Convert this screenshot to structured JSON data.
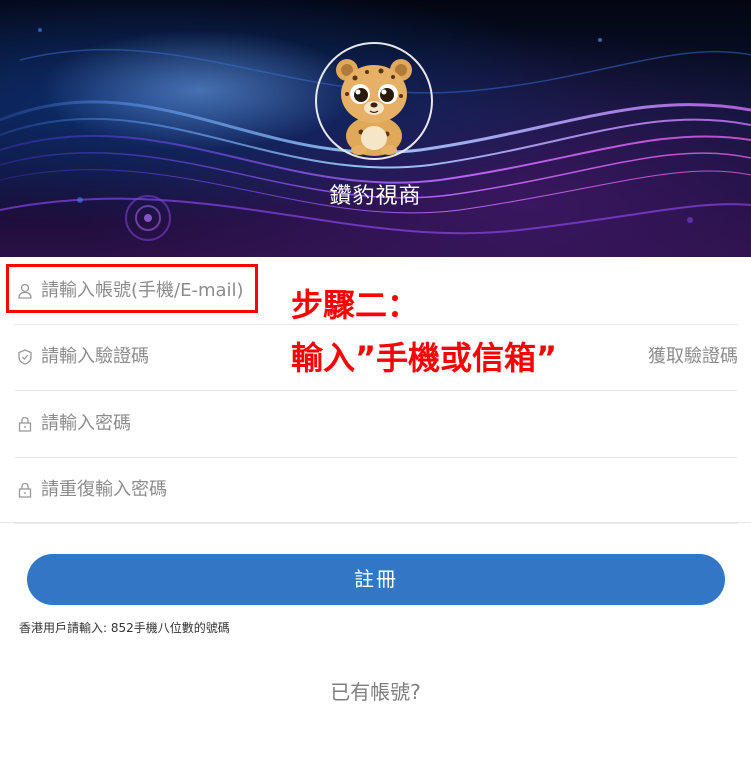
{
  "header": {
    "brand_name": "鑽豹視商",
    "logo_icon": "leopard-mascot-icon"
  },
  "form": {
    "account": {
      "placeholder": "請輸入帳號(手機/E-mail)",
      "icon": "user-icon"
    },
    "verification": {
      "placeholder": "請輸入驗證碼",
      "icon": "shield-icon",
      "get_code_label": "獲取驗證碼"
    },
    "password": {
      "placeholder": "請輸入密碼",
      "icon": "lock-icon"
    },
    "password_confirm": {
      "placeholder": "請重復輸入密碼",
      "icon": "lock-icon"
    },
    "register_label": "註冊",
    "hint": "香港用戶請輸入: 852手機八位數的號碼",
    "login_link": "已有帳號?"
  },
  "annotation": {
    "line1": "步驟二：",
    "line2": "輸入”手機或信箱”",
    "color": "#ff0000"
  },
  "colors": {
    "primary_button": "#3277c5",
    "placeholder": "#8c8c8c",
    "divider": "#e8e8e8"
  }
}
